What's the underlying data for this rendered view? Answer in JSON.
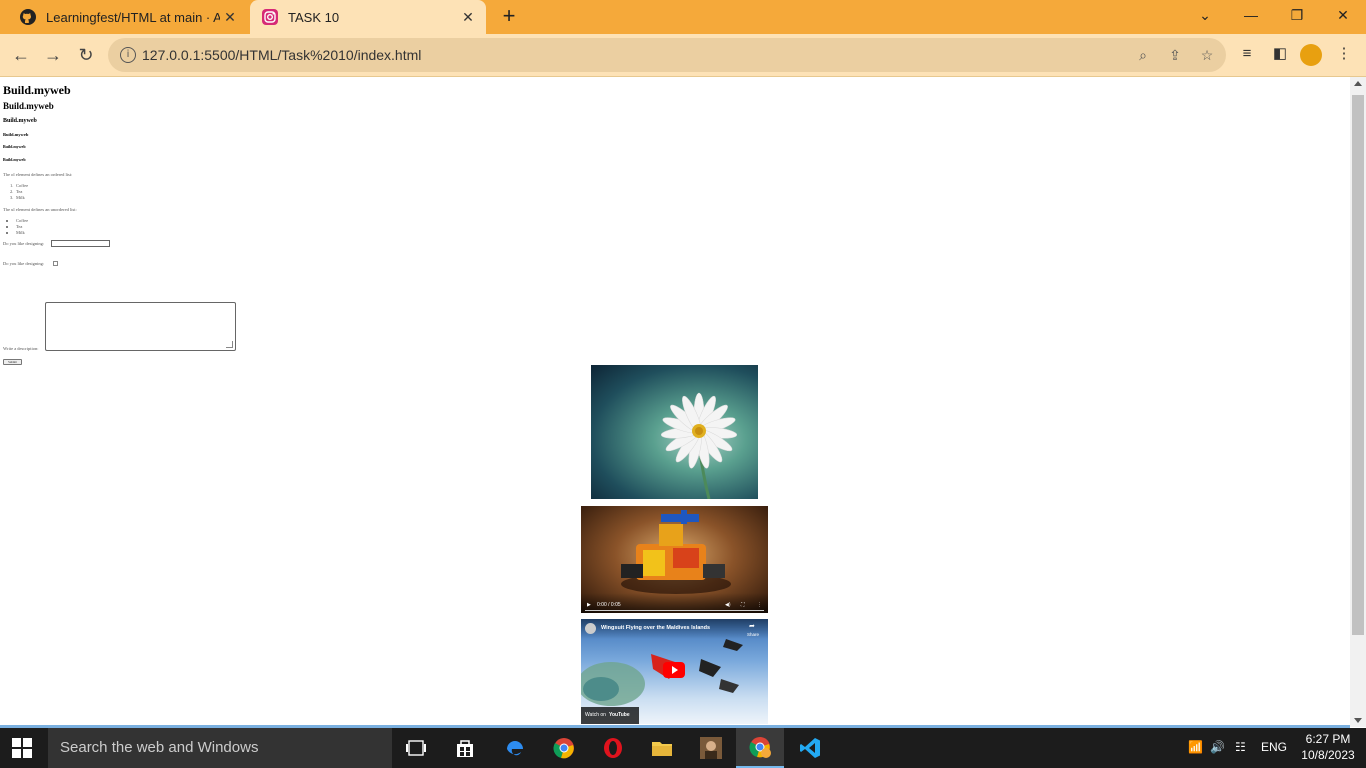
{
  "browser": {
    "tabs": [
      {
        "title": "Learningfest/HTML at main · Any",
        "favicon": "github-icon",
        "active": false
      },
      {
        "title": "TASK 10",
        "favicon": "instagram-icon",
        "active": true
      }
    ],
    "url": "127.0.0.1:5500/HTML/Task%2010/index.html"
  },
  "page": {
    "headings": [
      "Build.myweb",
      "Build.myweb",
      "Build.myweb",
      "Build.myweb",
      "Build.myweb",
      "Build.myweb"
    ],
    "ol_intro": "The ol element defines an ordered list:",
    "ol_items": [
      "Coffee",
      "Tea",
      "Milk"
    ],
    "ul_intro": "The ul element defines an unordered list:",
    "ul_items": [
      "Coffee",
      "Tea",
      "Milk"
    ],
    "input_label": "Do you like designing:",
    "checkbox_label": "Do you like designing:",
    "textarea_label": "Write a description:",
    "submit_label": "Submit",
    "video_time": "0:00 / 0:05",
    "youtube_title": "Wingsuit Flying over the Maldives Islands",
    "youtube_share": "Share",
    "youtube_watch": "Watch on",
    "youtube_brand": "YouTube"
  },
  "taskbar": {
    "search_placeholder": "Search the web and Windows",
    "language": "ENG",
    "time": "6:27 PM",
    "date": "10/8/2023"
  }
}
